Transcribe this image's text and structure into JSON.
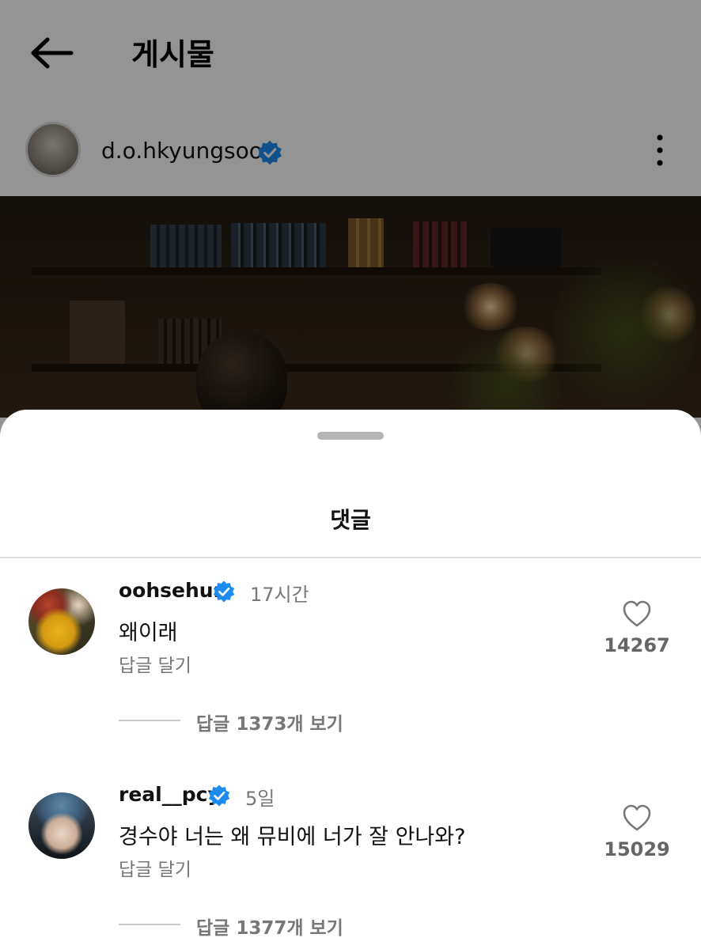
{
  "header": {
    "title": "게시물"
  },
  "post": {
    "author": "d.o.hkyungsoo"
  },
  "sheet": {
    "title": "댓글"
  },
  "comments": [
    {
      "username": "oohsehun",
      "time": "17시간",
      "text": "왜이래",
      "reply_label": "답글 달기",
      "likes": "14267",
      "view_replies": "답글 1373개 보기"
    },
    {
      "username": "real__pcy",
      "time": "5일",
      "text": "경수야 너는 왜 뮤비에 너가 잘 안나와?",
      "reply_label": "답글 달기",
      "likes": "15029",
      "view_replies": "답글 1377개 보기"
    }
  ],
  "colors": {
    "verified": "#1d8cf0",
    "dim_overlay": "rgba(0,0,0,0.42)"
  },
  "icons": [
    "back-arrow-icon",
    "verified-badge-icon",
    "more-options-icon",
    "heart-icon"
  ]
}
